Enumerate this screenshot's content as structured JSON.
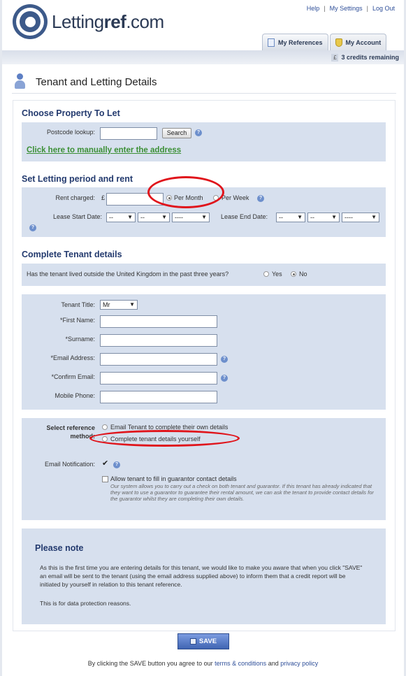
{
  "brand": {
    "prefix": "Letting",
    "bold": "ref",
    "suffix": ".com"
  },
  "toplinks": [
    "Help",
    "My Settings",
    "Log Out"
  ],
  "tabs": [
    {
      "label": "My References"
    },
    {
      "label": "My Account"
    }
  ],
  "credits": {
    "symbol": "£",
    "text": "3 credits remaining"
  },
  "page_title": "Tenant and Letting Details",
  "property": {
    "title": "Choose Property To Let",
    "postcode_label": "Postcode lookup:",
    "postcode_value": "",
    "search_label": "Search",
    "manual_link": "Click here to manually enter the address"
  },
  "letting": {
    "title": "Set Letting period and rent",
    "rent_label": "Rent charged:",
    "currency": "£",
    "rent_value": "",
    "per_month": "Per Month",
    "per_week": "Per Week",
    "selected_period": "Per Month",
    "lease_start_label": "Lease Start Date:",
    "lease_end_label": "Lease End Date:",
    "day_placeholder": "--",
    "month_placeholder": "--",
    "year_placeholder": "----"
  },
  "tenant": {
    "title": "Complete Tenant details",
    "outside_uk_question": "Has the tenant lived outside the United Kingdom in the past three years?",
    "yes_label": "Yes",
    "no_label": "No",
    "outside_uk_selected": "No",
    "title_label": "Tenant Title:",
    "title_value": "Mr",
    "first_name_label": "First Name:",
    "surname_label": "Surname:",
    "email_label": "Email Address:",
    "confirm_email_label": "Confirm Email:",
    "mobile_label": "Mobile Phone:",
    "required_mark": "*"
  },
  "reference": {
    "method_label_line1": "Select reference",
    "method_label_line2": "method:",
    "option_email": "Email Tenant to complete their own details",
    "option_self": "Complete tenant details yourself",
    "email_notification_label": "Email Notification:",
    "email_notification_checked": true,
    "guarantor_label": "Allow tenant to fill in guarantor contact details",
    "guarantor_note": "Our system allows you to carry out a check on both tenant and guarantor. If this tenant has already indicated that they want to use a guarantor to guarantee their rental amount, we can ask the tenant to provide contact details for the guarantor whilst they are completing their own details."
  },
  "note": {
    "title": "Please note",
    "para1": "As this is the first time you are entering details for this tenant, we would like to make you aware that when you click \"SAVE\" an email will be sent to the tenant (using the email address supplied above) to inform them that a credit report will be initiated by yourself in relation to this tenant reference.",
    "para2": "This is for data protection reasons."
  },
  "save_label": "SAVE",
  "footer": {
    "prefix": "By clicking the SAVE button you agree to our",
    "terms": "terms & conditions",
    "and": "and",
    "privacy": "privacy policy"
  },
  "colors": {
    "accent": "#233a6e",
    "box": "#d7e0ee",
    "annotation": "#e0141b",
    "link_green": "#3b8f35"
  }
}
